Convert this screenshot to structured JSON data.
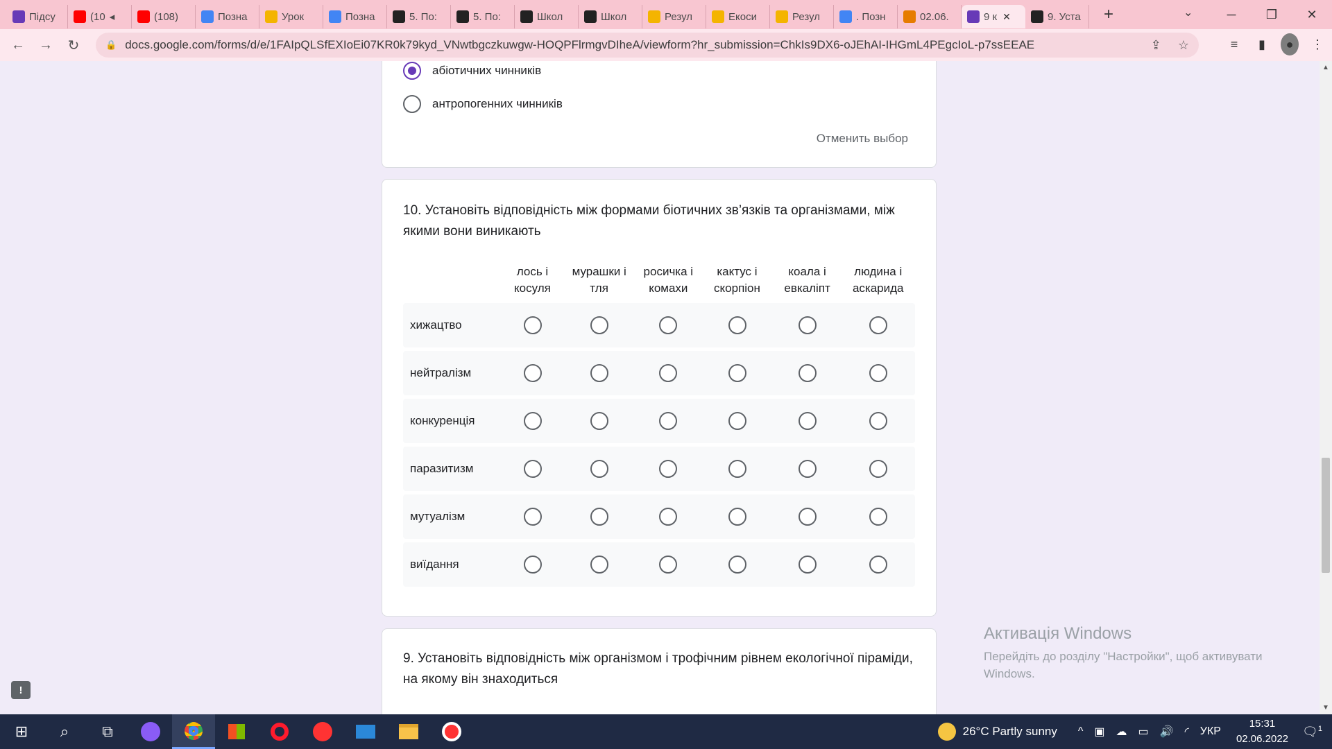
{
  "browser": {
    "tabs": [
      {
        "label": "Підсу",
        "icon": "forms-icon",
        "color": "#673ab7"
      },
      {
        "label": "(10",
        "icon": "youtube-icon",
        "color": "#ff0000",
        "muted": true
      },
      {
        "label": "(108)",
        "icon": "youtube-icon",
        "color": "#ff0000"
      },
      {
        "label": "Позна",
        "icon": "google-icon",
        "color": "#4285f4"
      },
      {
        "label": "Урок",
        "icon": "bell-icon",
        "color": "#f4b400"
      },
      {
        "label": "Позна",
        "icon": "google-icon",
        "color": "#4285f4"
      },
      {
        "label": "5. По:",
        "icon": "z-icon",
        "color": "#222222"
      },
      {
        "label": "5. По:",
        "icon": "z-icon",
        "color": "#222222"
      },
      {
        "label": "Школ",
        "icon": "z-icon",
        "color": "#222222"
      },
      {
        "label": "Школ",
        "icon": "z-icon",
        "color": "#222222"
      },
      {
        "label": "Резул",
        "icon": "bell-icon",
        "color": "#f4b400"
      },
      {
        "label": "Екоси",
        "icon": "bell-icon",
        "color": "#f4b400"
      },
      {
        "label": "Резул",
        "icon": "bell-icon",
        "color": "#f4b400"
      },
      {
        "label": ". Позн",
        "icon": "google-icon",
        "color": "#4285f4"
      },
      {
        "label": "02.06.",
        "icon": "classroom-icon",
        "color": "#e67c00"
      },
      {
        "label": "9 к",
        "icon": "forms-icon",
        "color": "#673ab7",
        "active": true
      },
      {
        "label": "9. Уста",
        "icon": "z-icon",
        "color": "#222222"
      }
    ],
    "new_tab": "+",
    "url": "docs.google.com/forms/d/e/1FAIpQLSfEXIoEi07KR0k79kyd_VNwtbgczkuwgw-HOQPFlrmgvDIheA/viewform?hr_submission=ChkIs9DX6-oJEhAI-IHGmL4PEgcIoL-p7ssEEAE"
  },
  "form": {
    "prev_question": {
      "options": [
        "абіотичних чинників",
        "антропогенних чинників"
      ],
      "selected_index": 0,
      "clear_label": "Отменить выбор"
    },
    "question10": {
      "title": "10. Установіть відповідність між формами біотичних зв’язків та організмами, між якими вони виникають",
      "columns": [
        [
          "лось і",
          "косуля"
        ],
        [
          "мурашки і",
          "тля"
        ],
        [
          "росичка і",
          "комахи"
        ],
        [
          "кактус і",
          "скорпіон"
        ],
        [
          "коала і",
          "евкаліпт"
        ],
        [
          "людина і",
          "аскарида"
        ]
      ],
      "rows": [
        "хижацтво",
        "нейтралізм",
        "конкуренція",
        "паразитизм",
        "мутуалізм",
        "виїдання"
      ]
    },
    "question9": {
      "title": "9. Установіть відповідність між організмом і трофічним рівнем екологічної піраміди, на якому він знаходиться"
    }
  },
  "watermark": {
    "title": "Активація Windows",
    "text": "Перейдіть до розділу \"Настройки\", щоб активувати Windows."
  },
  "taskbar": {
    "weather": "26°C  Partly sunny",
    "language": "УКР",
    "time": "15:31",
    "date": "02.06.2022",
    "notifications": "1"
  }
}
